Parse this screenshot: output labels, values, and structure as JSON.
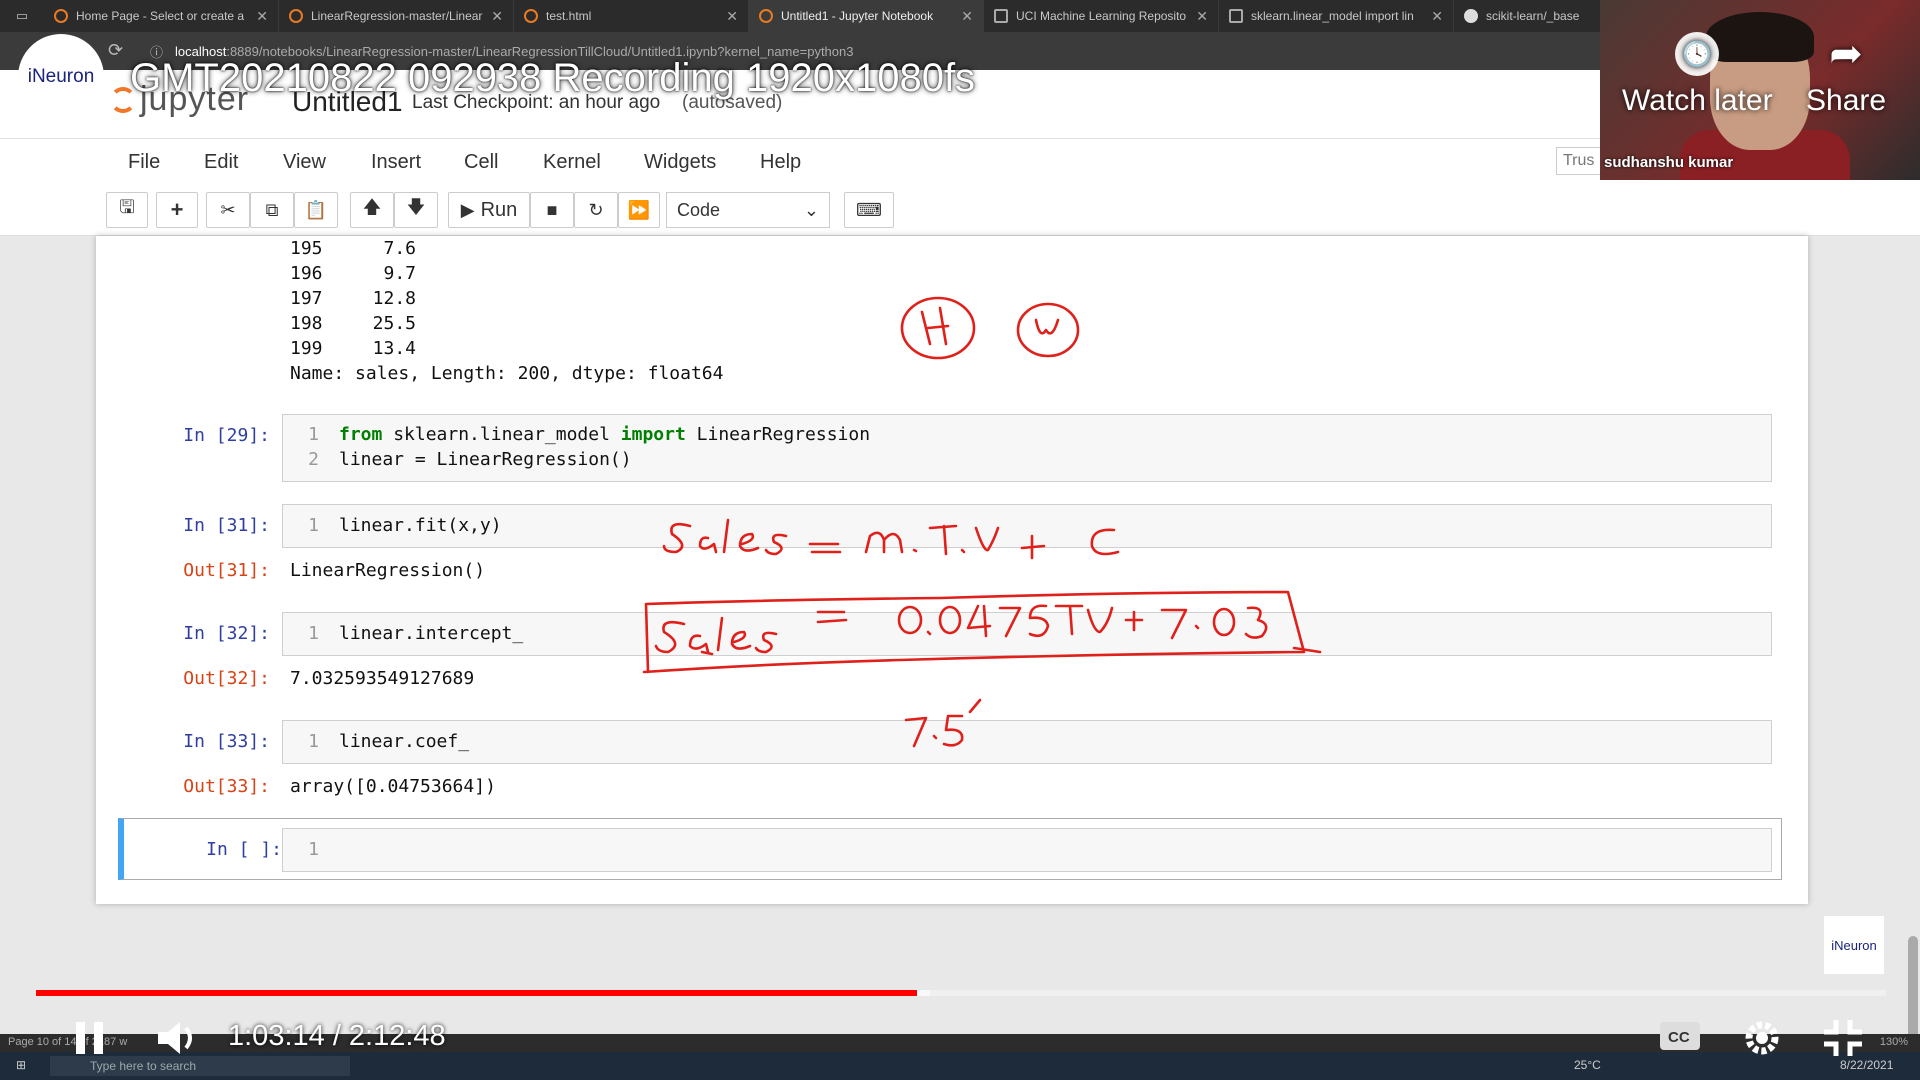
{
  "browser": {
    "tabs": [
      {
        "title": "Home Page - Select or create a",
        "favicon": "jupyter-icon"
      },
      {
        "title": "LinearRegression-master/Linear",
        "favicon": "jupyter-icon"
      },
      {
        "title": "test.html",
        "favicon": "jupyter-icon"
      },
      {
        "title": "Untitled1 - Jupyter Notebook",
        "favicon": "jupyter-icon"
      },
      {
        "title": "UCI Machine Learning Reposito",
        "favicon": "document-icon"
      },
      {
        "title": "sklearn.linear_model import lin",
        "favicon": "globe-icon"
      },
      {
        "title": "scikit-learn/_base",
        "favicon": "github-icon"
      }
    ],
    "url_host": "localhost",
    "url_path": ":8889/notebooks/LinearRegression-master/LinearRegressionTillCloud/Untitled1.ipynb?kernel_name=python3"
  },
  "jupyter": {
    "logo_text": "jupyter",
    "notebook_title": "Untitled1",
    "checkpoint": "Last Checkpoint: an hour ago",
    "autosave": "(autosaved)",
    "menu": [
      "File",
      "Edit",
      "View",
      "Insert",
      "Cell",
      "Kernel",
      "Widgets",
      "Help"
    ],
    "trusted": "Trus",
    "toolbar": {
      "run_label": "Run",
      "cell_type": "Code"
    }
  },
  "notebook": {
    "series_output": [
      {
        "index": "195",
        "value": "7.6"
      },
      {
        "index": "196",
        "value": "9.7"
      },
      {
        "index": "197",
        "value": "12.8"
      },
      {
        "index": "198",
        "value": "25.5"
      },
      {
        "index": "199",
        "value": "13.4"
      }
    ],
    "series_footer": "Name: sales, Length: 200, dtype: float64",
    "cells": [
      {
        "prompt": "In [29]:",
        "lines": [
          "1",
          "2"
        ],
        "code1_from": "from",
        "code1_mod": " sklearn.linear_model ",
        "code1_import": "import",
        "code1_rest": " LinearRegression",
        "code2": "linear = LinearRegression()"
      },
      {
        "prompt": "In [31]:",
        "line": "1",
        "code": "linear.fit(x,y)",
        "out_prompt": "Out[31]:",
        "output": "LinearRegression()"
      },
      {
        "prompt": "In [32]:",
        "line": "1",
        "code": "linear.intercept_",
        "out_prompt": "Out[32]:",
        "output": "7.032593549127689"
      },
      {
        "prompt": "In [33]:",
        "line": "1",
        "code": "linear.coef_",
        "out_prompt": "Out[33]:",
        "output": "array([0.04753664])"
      },
      {
        "prompt": "In [ ]:",
        "line": "1"
      }
    ]
  },
  "video": {
    "title": "GMT20210822 092938 Recording 1920x1080fs",
    "channel_logo": "iNeuron",
    "watch_later": "Watch later",
    "share": "Share",
    "presenter": "sudhanshu kumar",
    "time_display": "1:03:14 / 2:12:48",
    "progress_fraction": 0.476,
    "buffered_fraction": 0.483,
    "corner_logo": "iNeuron"
  },
  "taskbar": {
    "search_placeholder": "Type here to search",
    "word_status": "Page 10 of 14   of 2187 w",
    "temperature": "25°C",
    "date": "8/22/2021",
    "zoom": "130%"
  }
}
